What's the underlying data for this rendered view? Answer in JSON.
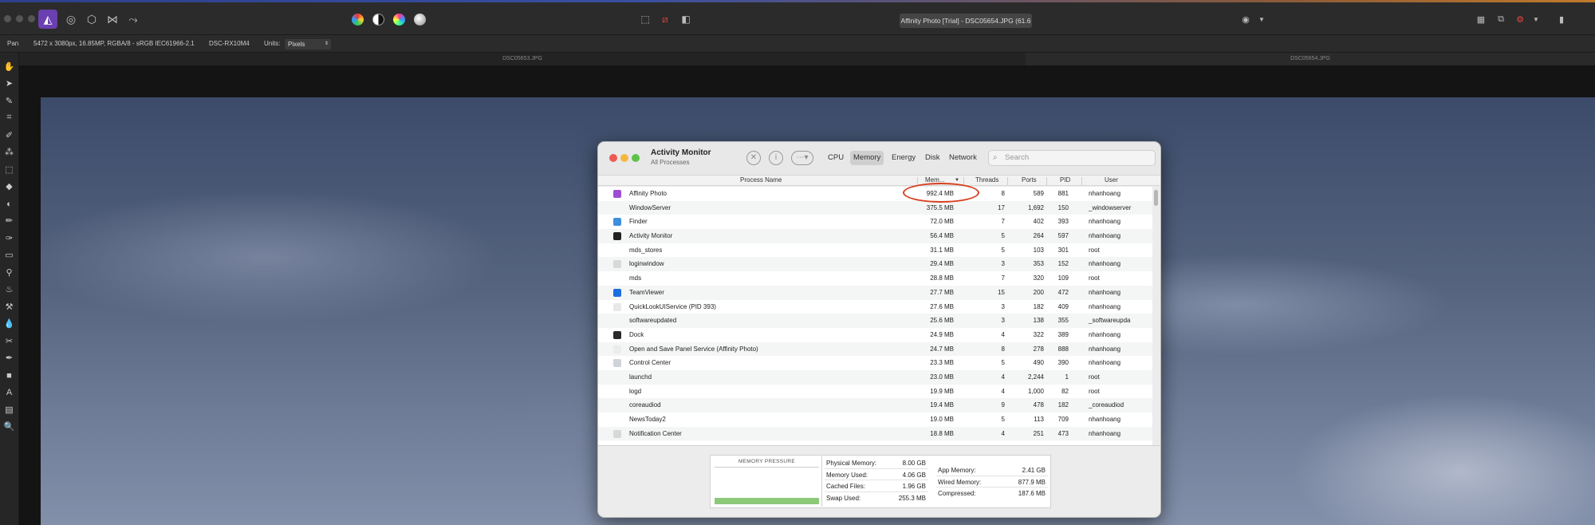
{
  "context_bar": {
    "tool": "Pan",
    "image_info": "5472 x 3080px, 16.85MP, RGBA/8 - sRGB IEC61966-2.1",
    "camera": "DSC-RX10M4",
    "units_label": "Units:",
    "units_value": "Pixels"
  },
  "doc_title": "Affinity Photo [Trial] - DSC05654.JPG (61.6",
  "doc_tabs": [
    "DSC05653.JPG",
    "DSC05654.JPG"
  ],
  "activity_monitor": {
    "title": "Activity Monitor",
    "subtitle": "All Processes",
    "tabs": [
      "CPU",
      "Memory",
      "Energy",
      "Disk",
      "Network"
    ],
    "active_tab": "Memory",
    "search_placeholder": "Search",
    "columns": {
      "process_name": "Process Name",
      "memory": "Mem...",
      "threads": "Threads",
      "ports": "Ports",
      "pid": "PID",
      "user": "User"
    },
    "processes": [
      {
        "name": "Affinity Photo",
        "memory": "992.4 MB",
        "threads": "8",
        "ports": "589",
        "pid": "881",
        "user": "nhanhoang",
        "icon": "affinity-photo-icon",
        "color": "#9b4fd6"
      },
      {
        "name": "WindowServer",
        "memory": "375.5 MB",
        "threads": "17",
        "ports": "1,692",
        "pid": "150",
        "user": "_windowserver",
        "icon": "",
        "color": ""
      },
      {
        "name": "Finder",
        "memory": "72.0 MB",
        "threads": "7",
        "ports": "402",
        "pid": "393",
        "user": "nhanhoang",
        "icon": "finder-icon",
        "color": "#3d8fe0"
      },
      {
        "name": "Activity Monitor",
        "memory": "56.4 MB",
        "threads": "5",
        "ports": "264",
        "pid": "597",
        "user": "nhanhoang",
        "icon": "activity-monitor-icon",
        "color": "#222222"
      },
      {
        "name": "mds_stores",
        "memory": "31.1 MB",
        "threads": "5",
        "ports": "103",
        "pid": "301",
        "user": "root",
        "icon": "",
        "color": ""
      },
      {
        "name": "loginwindow",
        "memory": "29.4 MB",
        "threads": "3",
        "ports": "353",
        "pid": "152",
        "user": "nhanhoang",
        "icon": "loginwindow-icon",
        "color": "#d8d8d8"
      },
      {
        "name": "mds",
        "memory": "28.8 MB",
        "threads": "7",
        "ports": "320",
        "pid": "109",
        "user": "root",
        "icon": "",
        "color": ""
      },
      {
        "name": "TeamViewer",
        "memory": "27.7 MB",
        "threads": "15",
        "ports": "200",
        "pid": "472",
        "user": "nhanhoang",
        "icon": "teamviewer-icon",
        "color": "#1a6ee0"
      },
      {
        "name": "QuickLookUIService (PID 393)",
        "memory": "27.6 MB",
        "threads": "3",
        "ports": "182",
        "pid": "409",
        "user": "nhanhoang",
        "icon": "quicklook-icon",
        "color": "#e8e8e8"
      },
      {
        "name": "softwareupdated",
        "memory": "25.6 MB",
        "threads": "3",
        "ports": "138",
        "pid": "355",
        "user": "_softwareupda",
        "icon": "",
        "color": ""
      },
      {
        "name": "Dock",
        "memory": "24.9 MB",
        "threads": "4",
        "ports": "322",
        "pid": "389",
        "user": "nhanhoang",
        "icon": "dock-icon",
        "color": "#2a2a2a"
      },
      {
        "name": "Open and Save Panel Service (Affinity Photo)",
        "memory": "24.7 MB",
        "threads": "8",
        "ports": "278",
        "pid": "888",
        "user": "nhanhoang",
        "icon": "panel-service-icon",
        "color": "#ececec"
      },
      {
        "name": "Control Center",
        "memory": "23.3 MB",
        "threads": "5",
        "ports": "490",
        "pid": "390",
        "user": "nhanhoang",
        "icon": "control-center-icon",
        "color": "#cfd4da"
      },
      {
        "name": "launchd",
        "memory": "23.0 MB",
        "threads": "4",
        "ports": "2,244",
        "pid": "1",
        "user": "root",
        "icon": "",
        "color": ""
      },
      {
        "name": "logd",
        "memory": "19.9 MB",
        "threads": "4",
        "ports": "1,000",
        "pid": "82",
        "user": "root",
        "icon": "",
        "color": ""
      },
      {
        "name": "coreaudiod",
        "memory": "19.4 MB",
        "threads": "9",
        "ports": "478",
        "pid": "182",
        "user": "_coreaudiod",
        "icon": "",
        "color": ""
      },
      {
        "name": "NewsToday2",
        "memory": "19.0 MB",
        "threads": "5",
        "ports": "113",
        "pid": "709",
        "user": "nhanhoang",
        "icon": "",
        "color": ""
      },
      {
        "name": "Notification Center",
        "memory": "18.8 MB",
        "threads": "4",
        "ports": "251",
        "pid": "473",
        "user": "nhanhoang",
        "icon": "notification-center-icon",
        "color": "#d8d8d8"
      }
    ],
    "memory_pressure": {
      "label": "MEMORY PRESSURE",
      "level": 0.15,
      "color": "#8cc979"
    },
    "stats_left": [
      {
        "label": "Physical Memory:",
        "value": "8.00 GB"
      },
      {
        "label": "Memory Used:",
        "value": "4.06 GB"
      },
      {
        "label": "Cached Files:",
        "value": "1.96 GB"
      },
      {
        "label": "Swap Used:",
        "value": "255.3 MB"
      }
    ],
    "stats_right": [
      {
        "label": "App Memory:",
        "value": "2.41 GB"
      },
      {
        "label": "Wired Memory:",
        "value": "877.9 MB"
      },
      {
        "label": "Compressed:",
        "value": "187.6 MB"
      }
    ]
  },
  "colors": {
    "highlight_circle": "#d8401f",
    "persona_active": "#6a3fb0"
  }
}
